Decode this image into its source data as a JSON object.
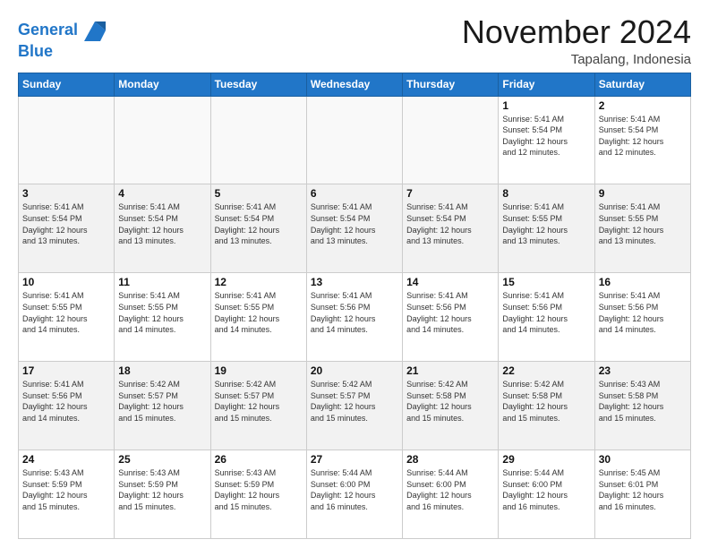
{
  "header": {
    "logo_line1": "General",
    "logo_line2": "Blue",
    "month_title": "November 2024",
    "subtitle": "Tapalang, Indonesia"
  },
  "days_of_week": [
    "Sunday",
    "Monday",
    "Tuesday",
    "Wednesday",
    "Thursday",
    "Friday",
    "Saturday"
  ],
  "weeks": [
    [
      {
        "day": "",
        "info": ""
      },
      {
        "day": "",
        "info": ""
      },
      {
        "day": "",
        "info": ""
      },
      {
        "day": "",
        "info": ""
      },
      {
        "day": "",
        "info": ""
      },
      {
        "day": "1",
        "info": "Sunrise: 5:41 AM\nSunset: 5:54 PM\nDaylight: 12 hours\nand 12 minutes."
      },
      {
        "day": "2",
        "info": "Sunrise: 5:41 AM\nSunset: 5:54 PM\nDaylight: 12 hours\nand 12 minutes."
      }
    ],
    [
      {
        "day": "3",
        "info": "Sunrise: 5:41 AM\nSunset: 5:54 PM\nDaylight: 12 hours\nand 13 minutes."
      },
      {
        "day": "4",
        "info": "Sunrise: 5:41 AM\nSunset: 5:54 PM\nDaylight: 12 hours\nand 13 minutes."
      },
      {
        "day": "5",
        "info": "Sunrise: 5:41 AM\nSunset: 5:54 PM\nDaylight: 12 hours\nand 13 minutes."
      },
      {
        "day": "6",
        "info": "Sunrise: 5:41 AM\nSunset: 5:54 PM\nDaylight: 12 hours\nand 13 minutes."
      },
      {
        "day": "7",
        "info": "Sunrise: 5:41 AM\nSunset: 5:54 PM\nDaylight: 12 hours\nand 13 minutes."
      },
      {
        "day": "8",
        "info": "Sunrise: 5:41 AM\nSunset: 5:55 PM\nDaylight: 12 hours\nand 13 minutes."
      },
      {
        "day": "9",
        "info": "Sunrise: 5:41 AM\nSunset: 5:55 PM\nDaylight: 12 hours\nand 13 minutes."
      }
    ],
    [
      {
        "day": "10",
        "info": "Sunrise: 5:41 AM\nSunset: 5:55 PM\nDaylight: 12 hours\nand 14 minutes."
      },
      {
        "day": "11",
        "info": "Sunrise: 5:41 AM\nSunset: 5:55 PM\nDaylight: 12 hours\nand 14 minutes."
      },
      {
        "day": "12",
        "info": "Sunrise: 5:41 AM\nSunset: 5:55 PM\nDaylight: 12 hours\nand 14 minutes."
      },
      {
        "day": "13",
        "info": "Sunrise: 5:41 AM\nSunset: 5:56 PM\nDaylight: 12 hours\nand 14 minutes."
      },
      {
        "day": "14",
        "info": "Sunrise: 5:41 AM\nSunset: 5:56 PM\nDaylight: 12 hours\nand 14 minutes."
      },
      {
        "day": "15",
        "info": "Sunrise: 5:41 AM\nSunset: 5:56 PM\nDaylight: 12 hours\nand 14 minutes."
      },
      {
        "day": "16",
        "info": "Sunrise: 5:41 AM\nSunset: 5:56 PM\nDaylight: 12 hours\nand 14 minutes."
      }
    ],
    [
      {
        "day": "17",
        "info": "Sunrise: 5:41 AM\nSunset: 5:56 PM\nDaylight: 12 hours\nand 14 minutes."
      },
      {
        "day": "18",
        "info": "Sunrise: 5:42 AM\nSunset: 5:57 PM\nDaylight: 12 hours\nand 15 minutes."
      },
      {
        "day": "19",
        "info": "Sunrise: 5:42 AM\nSunset: 5:57 PM\nDaylight: 12 hours\nand 15 minutes."
      },
      {
        "day": "20",
        "info": "Sunrise: 5:42 AM\nSunset: 5:57 PM\nDaylight: 12 hours\nand 15 minutes."
      },
      {
        "day": "21",
        "info": "Sunrise: 5:42 AM\nSunset: 5:58 PM\nDaylight: 12 hours\nand 15 minutes."
      },
      {
        "day": "22",
        "info": "Sunrise: 5:42 AM\nSunset: 5:58 PM\nDaylight: 12 hours\nand 15 minutes."
      },
      {
        "day": "23",
        "info": "Sunrise: 5:43 AM\nSunset: 5:58 PM\nDaylight: 12 hours\nand 15 minutes."
      }
    ],
    [
      {
        "day": "24",
        "info": "Sunrise: 5:43 AM\nSunset: 5:59 PM\nDaylight: 12 hours\nand 15 minutes."
      },
      {
        "day": "25",
        "info": "Sunrise: 5:43 AM\nSunset: 5:59 PM\nDaylight: 12 hours\nand 15 minutes."
      },
      {
        "day": "26",
        "info": "Sunrise: 5:43 AM\nSunset: 5:59 PM\nDaylight: 12 hours\nand 15 minutes."
      },
      {
        "day": "27",
        "info": "Sunrise: 5:44 AM\nSunset: 6:00 PM\nDaylight: 12 hours\nand 16 minutes."
      },
      {
        "day": "28",
        "info": "Sunrise: 5:44 AM\nSunset: 6:00 PM\nDaylight: 12 hours\nand 16 minutes."
      },
      {
        "day": "29",
        "info": "Sunrise: 5:44 AM\nSunset: 6:00 PM\nDaylight: 12 hours\nand 16 minutes."
      },
      {
        "day": "30",
        "info": "Sunrise: 5:45 AM\nSunset: 6:01 PM\nDaylight: 12 hours\nand 16 minutes."
      }
    ]
  ],
  "colors": {
    "header_bg": "#2176c8",
    "alt_row_bg": "#f2f2f2",
    "empty_bg": "#f9f9f9"
  }
}
